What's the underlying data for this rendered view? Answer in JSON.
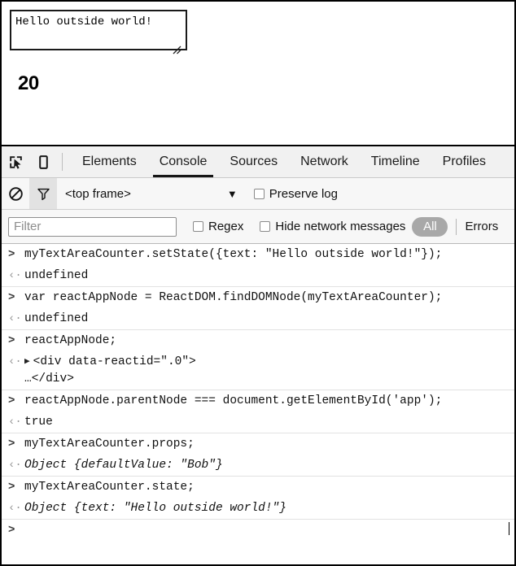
{
  "app_preview": {
    "textarea_value": "Hello outside world!",
    "textarea_name": "text-area-counter",
    "counter": "20"
  },
  "devtools": {
    "tabbar": {
      "inspect_icon": "inspect-element-icon",
      "device_icon": "device-toggle-icon",
      "tabs": [
        {
          "label": "Elements",
          "active": false
        },
        {
          "label": "Console",
          "active": true
        },
        {
          "label": "Sources",
          "active": false
        },
        {
          "label": "Network",
          "active": false
        },
        {
          "label": "Timeline",
          "active": false
        },
        {
          "label": "Profiles",
          "active": false
        }
      ]
    },
    "filterbar": {
      "clear_icon": "clear-console-icon",
      "filter_icon": "filter-funnel-icon",
      "frame_selector": "<top frame>",
      "caret": "▼",
      "preserve_log_label": "Preserve log",
      "preserve_log_checked": false
    },
    "filterrow": {
      "filter_placeholder": "Filter",
      "filter_value": "",
      "regex_label": "Regex",
      "regex_checked": false,
      "hide_network_label": "Hide network messages",
      "hide_network_checked": false,
      "level_all": "All",
      "level_errors": "Errors"
    },
    "console_entries": [
      {
        "input": "myTextAreaCounter.setState({text: \"Hello outside world!\"});",
        "output": "undefined",
        "output_italic": false,
        "expandable": false
      },
      {
        "input": "var reactAppNode = ReactDOM.findDOMNode(myTextAreaCounter);",
        "output": "undefined",
        "output_italic": false,
        "expandable": false
      },
      {
        "input": "reactAppNode;",
        "output": "<div data-reactid=\".0\">\n…</div>",
        "output_italic": false,
        "expandable": true,
        "disclosure": "▶"
      },
      {
        "input": "reactAppNode.parentNode === document.getElementById('app');",
        "output": "true",
        "output_italic": false,
        "expandable": false
      },
      {
        "input": "myTextAreaCounter.props;",
        "output": "Object {defaultValue: \"Bob\"}",
        "output_italic": true,
        "expandable": false
      },
      {
        "input": "myTextAreaCounter.state;",
        "output": "Object {text: \"Hello outside world!\"}",
        "output_italic": true,
        "expandable": false
      }
    ],
    "prompt": {
      "chevron": ">",
      "value": ""
    },
    "gutter_in": ">",
    "gutter_out": "‹·"
  },
  "colors": {
    "border": "#000000",
    "tabbar_bg": "#f1f1f1",
    "filter_bg": "#f7f7f7",
    "active_tab_underline": "#151515",
    "pill_bg": "#a8a8a8",
    "console_bg": "#ffffff",
    "separator": "#e2e2e2"
  }
}
